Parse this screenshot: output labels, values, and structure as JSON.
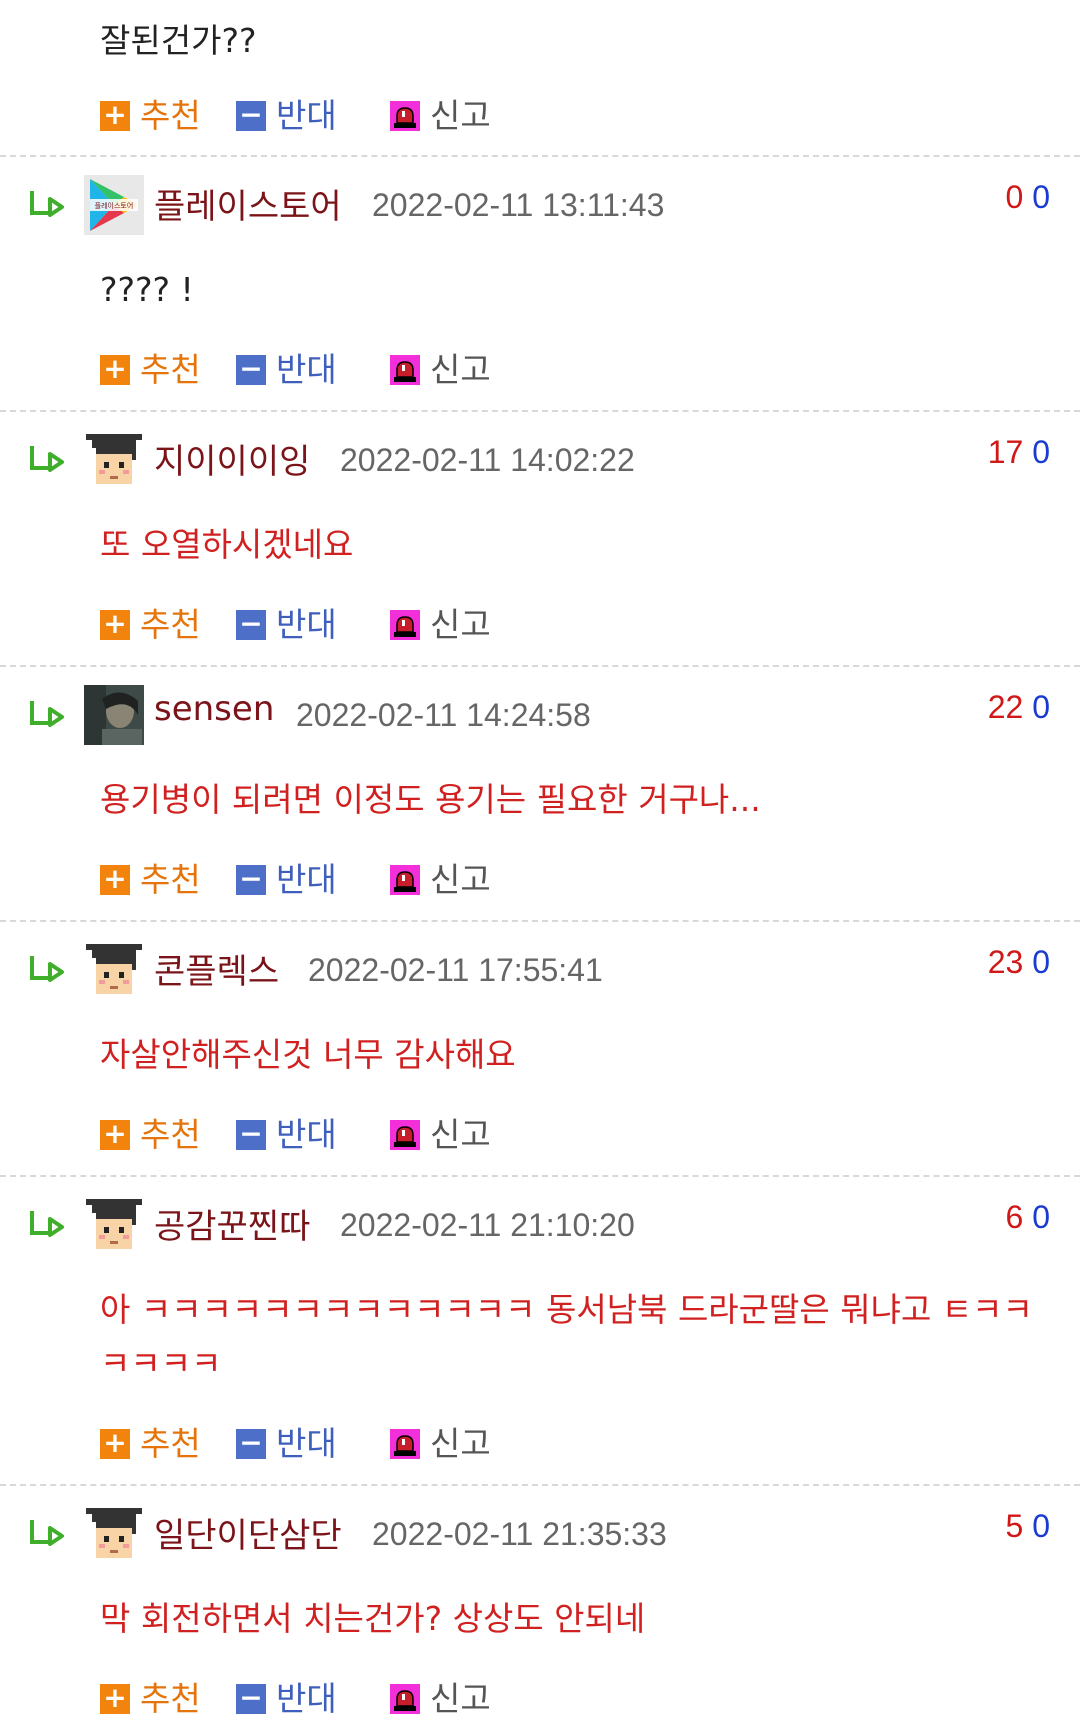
{
  "top_comment": {
    "text": "잘된건가??"
  },
  "actions": {
    "recommend": "추천",
    "oppose": "반대",
    "report": "신고"
  },
  "comments": [
    {
      "nick": "플레이스토어",
      "date": "2022-02-11 13:11:43",
      "up": "0",
      "down": "0",
      "text": "???? !",
      "avatar": "play-store-icon"
    },
    {
      "nick": "지이이이잉",
      "date": "2022-02-11 14:02:22",
      "up": "17",
      "down": "0",
      "text": "또 오열하시겠네요",
      "avatar": "graduate-avatar-icon"
    },
    {
      "nick": "sensen",
      "date": "2022-02-11 14:24:58",
      "up": "22",
      "down": "0",
      "text": "용기병이 되려면 이정도 용기는 필요한 거구나...",
      "avatar": "photo-avatar"
    },
    {
      "nick": "콘플렉스",
      "date": "2022-02-11 17:55:41",
      "up": "23",
      "down": "0",
      "text": "자살안해주신것 너무 감사해요",
      "avatar": "graduate-avatar-icon"
    },
    {
      "nick": "공감꾼찐따",
      "date": "2022-02-11 21:10:20",
      "up": "6",
      "down": "0",
      "text": "아 ㅋㅋㅋㅋㅋㅋㅋㅋㅋㅋㅋㅋㅋ 동서남북 드라군딸은 뭐냐고 ㅌㅋㅋㅋㅋㅋㅋ",
      "avatar": "graduate-avatar-icon"
    },
    {
      "nick": "일단이단삼단",
      "date": "2022-02-11 21:35:33",
      "up": "5",
      "down": "0",
      "text": "막 회전하면서 치는건가? 상상도 안되네",
      "avatar": "graduate-avatar-icon"
    }
  ],
  "colors": {
    "nick": "#7a1418",
    "up_count": "#d01818",
    "down_count": "#1a3bd1",
    "recommend": "#f2830c",
    "oppose": "#4e6fc8",
    "report": "#f32fd9",
    "comment_text": "#d12020"
  }
}
